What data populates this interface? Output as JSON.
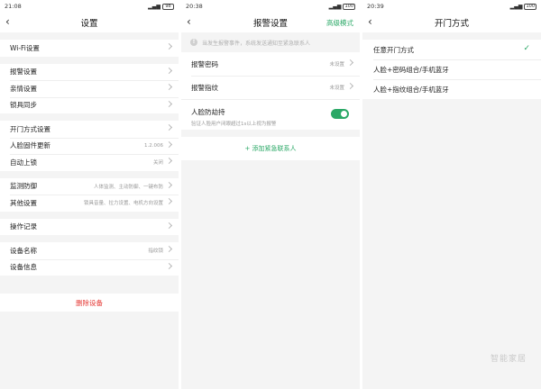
{
  "screen1": {
    "status": {
      "time": "21:08",
      "battery": "98"
    },
    "title": "设置",
    "rows": [
      {
        "label": "Wi-Fi设置",
        "value": ""
      },
      {
        "label": "报警设置",
        "value": ""
      },
      {
        "label": "亲情设置",
        "value": ""
      },
      {
        "label": "锁具同步",
        "value": ""
      },
      {
        "label": "开门方式设置",
        "value": ""
      },
      {
        "label": "人脸固件更新",
        "value": "1.2.006"
      },
      {
        "label": "自动上锁",
        "value": "关闭"
      },
      {
        "label": "监测防御",
        "value": "人体监测、主动防御、一键布防"
      },
      {
        "label": "其他设置",
        "value": "锁具音量、拉力设置、电机方向设置"
      },
      {
        "label": "操作记录",
        "value": ""
      },
      {
        "label": "设备名称",
        "value": "指纹锁"
      },
      {
        "label": "设备信息",
        "value": ""
      }
    ],
    "delete_label": "删除设备"
  },
  "screen2": {
    "status": {
      "time": "20:38",
      "battery": "100"
    },
    "title": "报警设置",
    "advanced_label": "高级模式",
    "notice": "当发生报警事件，系统发送通知至紧急联系人",
    "rows": [
      {
        "label": "报警密码",
        "value": "未设置"
      },
      {
        "label": "报警指纹",
        "value": "未设置"
      }
    ],
    "face_label": "人脸防劫持",
    "face_sub": "验证人脸用户闭眼超过1s以上视为报警",
    "face_toggle_on": true,
    "add_contact_label": "+ 添加紧急联系人",
    "accent_color": "#2aa866"
  },
  "screen3": {
    "status": {
      "time": "20:39",
      "battery": "100"
    },
    "title": "开门方式",
    "options": [
      {
        "label": "任意开门方式",
        "selected": true
      },
      {
        "label": "人脸+密码组合/手机蓝牙",
        "selected": false
      },
      {
        "label": "人脸+指纹组合/手机蓝牙",
        "selected": false
      }
    ],
    "checkmark": "✓"
  },
  "watermark": "智能家居"
}
